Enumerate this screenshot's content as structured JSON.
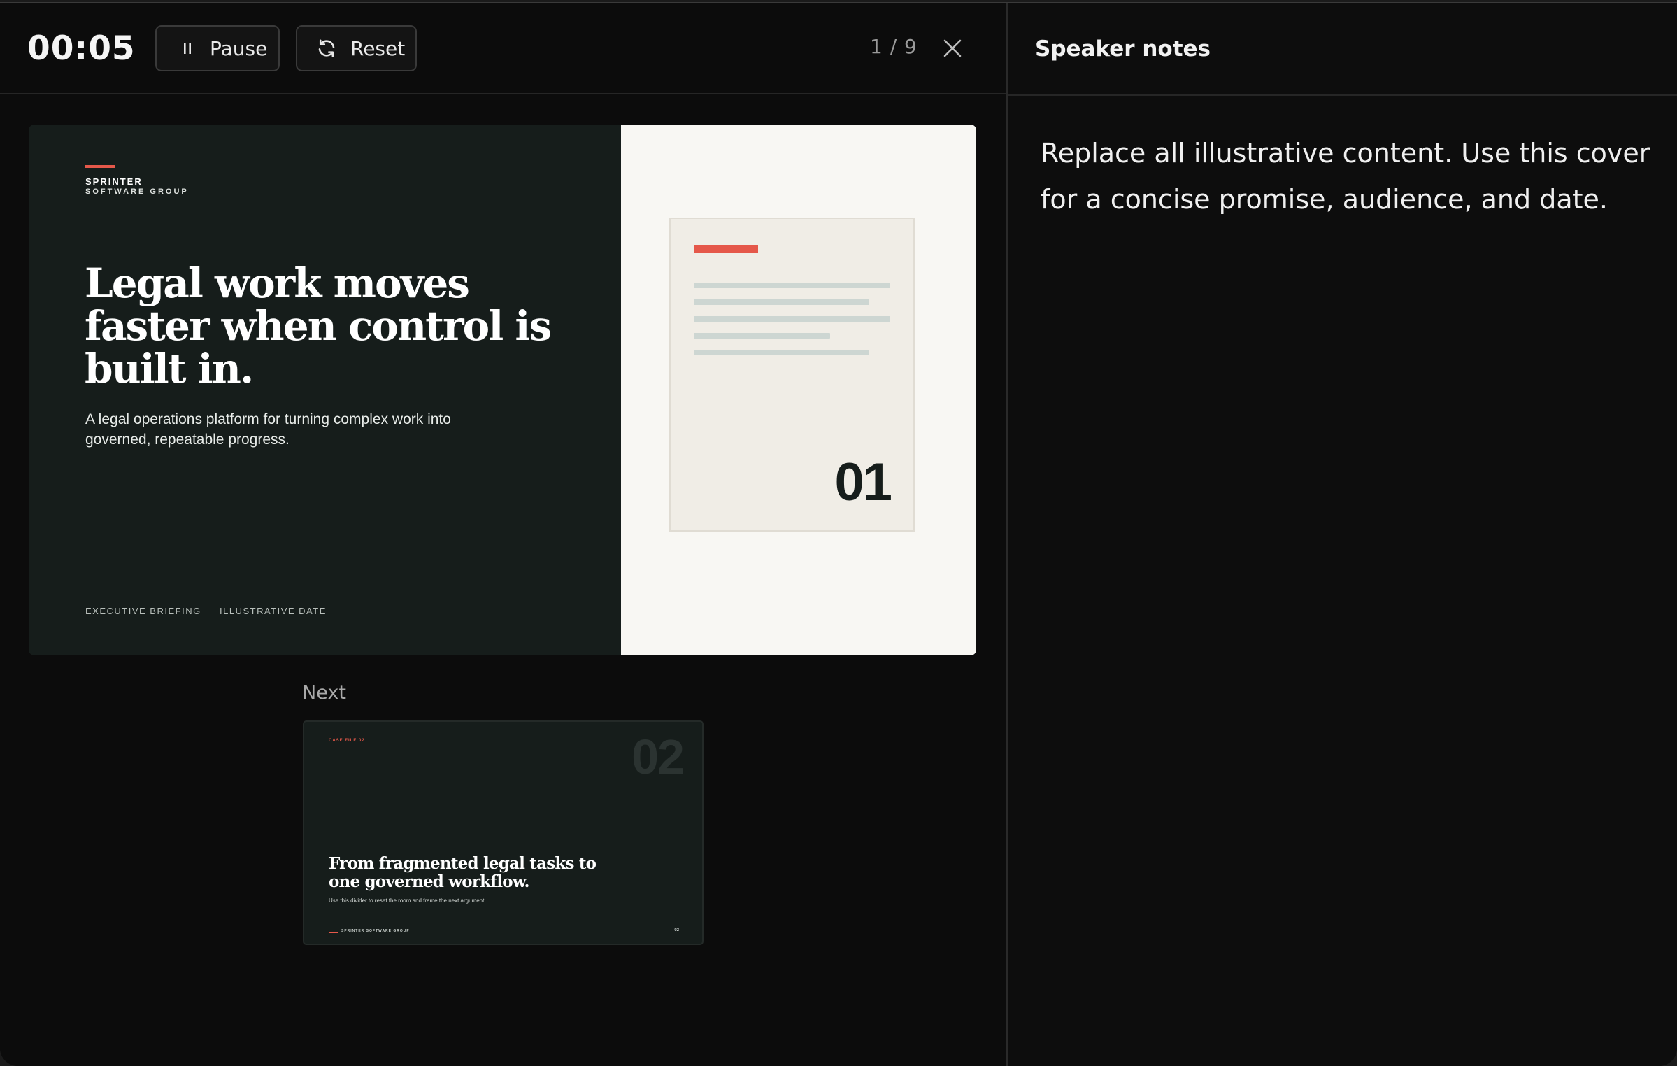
{
  "toolbar": {
    "timer": "00:05",
    "pause_label": "Pause",
    "reset_label": "Reset",
    "slide_counter": "1 / 9"
  },
  "current_slide": {
    "brand_line_1": "SPRINTER",
    "brand_line_2": "SOFTWARE GROUP",
    "title": "Legal work moves faster when control is built in.",
    "subtitle": "A legal operations platform for turning complex work into governed, repeatable progress.",
    "footer_left": "EXECUTIVE BRIEFING",
    "footer_right": "ILLUSTRATIVE DATE",
    "doc_number": "01"
  },
  "next_preview": {
    "label": "Next",
    "kicker": "CASE FILE 02",
    "number": "02",
    "title": "From fragmented legal tasks to one governed workflow.",
    "subtitle": "Use this divider to reset the room and frame the next argument.",
    "footer_brand": "SPRINTER SOFTWARE GROUP",
    "footer_page": "02"
  },
  "notes": {
    "title": "Speaker notes",
    "text": "Replace all illustrative content. Use this cover for a concise promise, audience, and date."
  },
  "colors": {
    "accent": "#e5584a",
    "slide_dark": "#161d1b",
    "slide_light": "#f8f7f3",
    "app_background": "#0d0d0d"
  },
  "icons": {
    "pause": "pause-icon",
    "reset": "refresh-icon",
    "close": "close-icon"
  }
}
